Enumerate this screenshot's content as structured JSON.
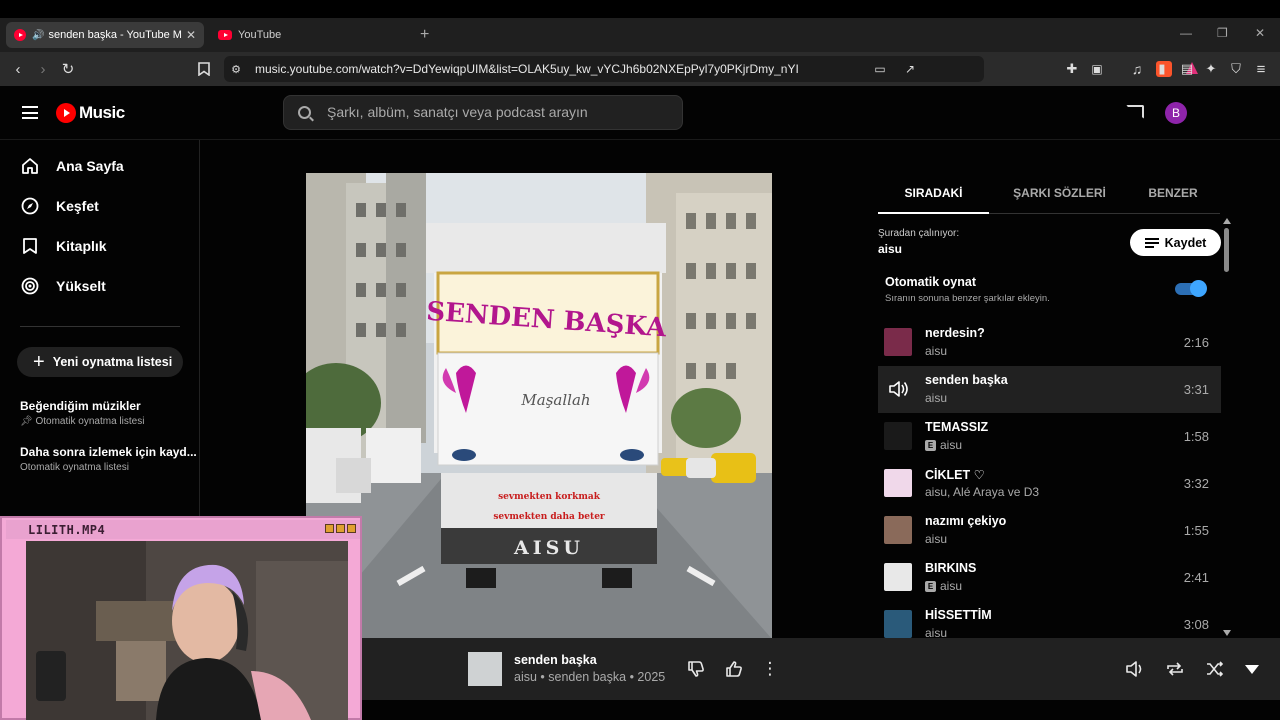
{
  "browser": {
    "tabs": [
      {
        "title": "senden başka - YouTube Music",
        "active": true
      },
      {
        "title": "YouTube",
        "active": false
      }
    ],
    "url": "music.youtube.com/watch?v=DdYewiqpUIM&list=OLAK5uy_kw_vYCJh6b02NXEpPyl7y0PKjrDmy_nYI",
    "brave_badge": "6"
  },
  "header": {
    "logo_text": "Music",
    "search_placeholder": "Şarkı, albüm, sanatçı veya podcast arayın",
    "avatar_letter": "B"
  },
  "sidebar": {
    "items": [
      {
        "label": "Ana Sayfa",
        "icon": "home-icon"
      },
      {
        "label": "Keşfet",
        "icon": "compass-icon"
      },
      {
        "label": "Kitaplık",
        "icon": "library-icon"
      },
      {
        "label": "Yükselt",
        "icon": "upgrade-icon"
      }
    ],
    "new_playlist": "Yeni oynatma listesi",
    "playlists": [
      {
        "title": "Beğendiğim müzikler",
        "subtitle": "Otomatik oynatma listesi",
        "pinned": true
      },
      {
        "title": "Daha sonra izlemek için kayd...",
        "subtitle": "Otomatik oynatma listesi",
        "pinned": false
      }
    ]
  },
  "artwork": {
    "sign_text": "SENDEN BAŞKA",
    "script_text": "Maşallah",
    "bumper_line1": "sevmekten korkmak",
    "bumper_line2": "sevmekten daha beter",
    "plate_text": "AISU"
  },
  "panel": {
    "tabs": [
      "SIRADAKİ",
      "ŞARKI SÖZLERİ",
      "BENZER"
    ],
    "active_tab": 0,
    "playing_from_label": "Şuradan çalınıyor:",
    "playing_from_name": "aisu",
    "save_label": "Kaydet",
    "autoplay_title": "Otomatik oynat",
    "autoplay_subtitle": "Sıranın sonuna benzer şarkılar ekleyin.",
    "autoplay_on": true
  },
  "queue": [
    {
      "title": "nerdesin?",
      "artist": "aisu",
      "duration": "2:16",
      "explicit": false,
      "playing": false,
      "thumb_color": "#7a2b4a"
    },
    {
      "title": "senden başka",
      "artist": "aisu",
      "duration": "3:31",
      "explicit": false,
      "playing": true,
      "thumb_color": "#cfd2d3"
    },
    {
      "title": "TEMASSIZ",
      "artist": "aisu",
      "duration": "1:58",
      "explicit": true,
      "playing": false,
      "thumb_color": "#1a1a1a"
    },
    {
      "title": "CİKLET ♡",
      "artist": "aisu, Alé Araya ve D3",
      "duration": "3:32",
      "explicit": false,
      "playing": false,
      "thumb_color": "#f0d8ea"
    },
    {
      "title": "nazımı çekiyo",
      "artist": "aisu",
      "duration": "1:55",
      "explicit": false,
      "playing": false,
      "thumb_color": "#8a6a5a"
    },
    {
      "title": "BIRKINS",
      "artist": "aisu",
      "duration": "2:41",
      "explicit": true,
      "playing": false,
      "thumb_color": "#e8e8e8"
    },
    {
      "title": "HİSSETTİM",
      "artist": "aisu",
      "duration": "3:08",
      "explicit": false,
      "playing": false,
      "thumb_color": "#2a5a7a"
    }
  ],
  "player": {
    "title": "senden başka",
    "subtitle": "aisu • senden başka • 2025"
  },
  "webcam": {
    "title": "LILITH.MP4"
  },
  "colors": {
    "accent_red": "#ff0000",
    "toggle_blue": "#3ea6ff",
    "background": "#030303",
    "avatar_purple": "#8e24aa",
    "webcam_pink": "#f4a9d6"
  }
}
